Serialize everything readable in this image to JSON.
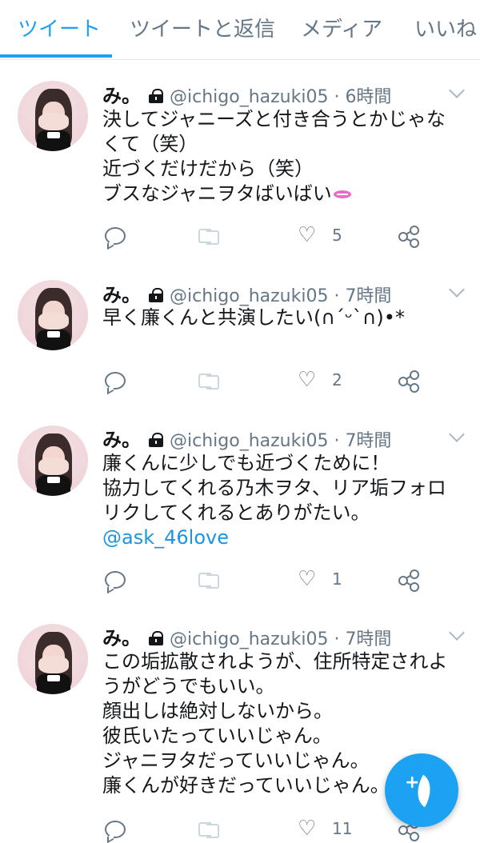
{
  "tabs": [
    {
      "label": "ツイート",
      "active": true
    },
    {
      "label": "ツイートと返信",
      "active": false
    },
    {
      "label": "メディア",
      "active": false
    },
    {
      "label": "いいね",
      "active": false
    }
  ],
  "accent_color": "#1da1f2",
  "tweets": [
    {
      "name": "み。",
      "handle": "@ichigo_hazuki05",
      "time": "· 6時間",
      "lines": [
        "決してジャニーズと付き合うとかじゃな",
        "くて（笑）",
        "近づくだけだから（笑）",
        "ブスなジャニヲタばいばい"
      ],
      "emoji_icon": "kiss-lips-icon",
      "mention": "",
      "likes": "5"
    },
    {
      "name": "み。",
      "handle": "@ichigo_hazuki05",
      "time": "· 7時間",
      "lines": [
        "早く廉くんと共演したい(∩´ᵕ`∩)•*"
      ],
      "mention": "",
      "likes": "2"
    },
    {
      "name": "み。",
      "handle": "@ichigo_hazuki05",
      "time": "· 7時間",
      "lines": [
        "廉くんに少しでも近づくために！",
        "協力してくれる乃木ヲタ、リア垢フォロ",
        "リクしてくれるとありがたい。"
      ],
      "mention": "@ask_46love",
      "likes": "1"
    },
    {
      "name": "み。",
      "handle": "@ichigo_hazuki05",
      "time": "· 7時間",
      "lines": [
        "この垢拡散されようが、住所特定されよ",
        "うがどうでもいい。",
        "顔出しは絶対しないから。",
        "彼氏いたっていいじゃん。",
        "ジャニヲタだっていいじゃん。",
        "廉くんが好きだっていいじゃん。"
      ],
      "mention": "",
      "likes": "11"
    }
  ],
  "fab": {
    "icon": "compose-tweet-icon",
    "symbol": "+"
  }
}
